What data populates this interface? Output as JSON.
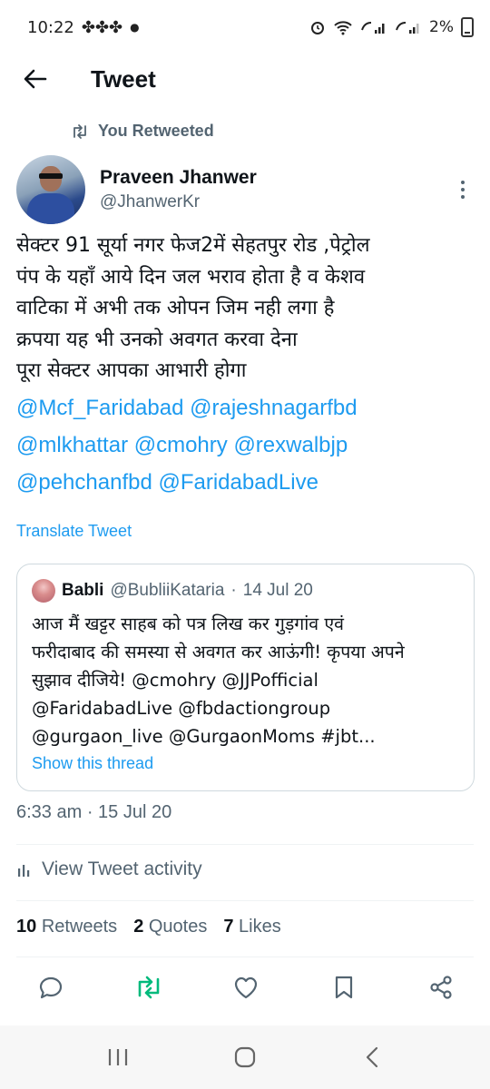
{
  "status": {
    "time": "10:22",
    "battery": "2%"
  },
  "header": {
    "title": "Tweet"
  },
  "retweet_context": "You Retweeted",
  "author": {
    "name": "Praveen Jhanwer",
    "handle": "@JhanwerKr"
  },
  "tweet": {
    "lines": [
      "सेक्टर 91 सूर्या नगर फेज2में सेहतपुर रोड ,पेट्रोल",
      "पंप के यहाँ आये दिन जल भराव होता है व केशव",
      "वाटिका में अभी तक ओपन जिम नही लगा है",
      "क्रपया यह भी उनको अवगत करवा देना",
      "पूरा सेक्टर आपका आभारी होगा"
    ],
    "mention_lines": [
      "@Mcf_Faridabad @rajeshnagarfbd",
      "@mlkhattar @cmohry @rexwalbjp",
      "@pehchanfbd @FaridabadLive"
    ],
    "translate_label": "Translate Tweet",
    "timestamp": "6:33 am · 15 Jul 20"
  },
  "quote": {
    "name": "Babli",
    "handle": "@BubliiKataria",
    "separator": "·",
    "date": "14 Jul 20",
    "lines": [
      "आज मैं खट्टर साहब को पत्र लिख कर गुड़गांव एवं",
      "फरीदाबाद की समस्या से अवगत कर आऊंगी! कृपया अपने",
      "सुझाव दीजिये! @cmohry @JJPofficial",
      "@FaridabadLive @fbdactiongroup",
      "@gurgaon_live @GurgaonMoms #jbt..."
    ],
    "show_thread": "Show this thread"
  },
  "activity_label": "View Tweet activity",
  "stats": {
    "retweets_count": "10",
    "retweets_label": "Retweets",
    "quotes_count": "2",
    "quotes_label": "Quotes",
    "likes_count": "7",
    "likes_label": "Likes"
  },
  "colors": {
    "accent": "#1d9bf0",
    "retweet_active": "#00ba7c",
    "secondary_text": "#536471"
  },
  "icons": [
    "back-arrow-icon",
    "retweet-icon",
    "more-icon",
    "reply-icon",
    "like-icon",
    "bookmark-icon",
    "share-icon",
    "analytics-icon"
  ]
}
